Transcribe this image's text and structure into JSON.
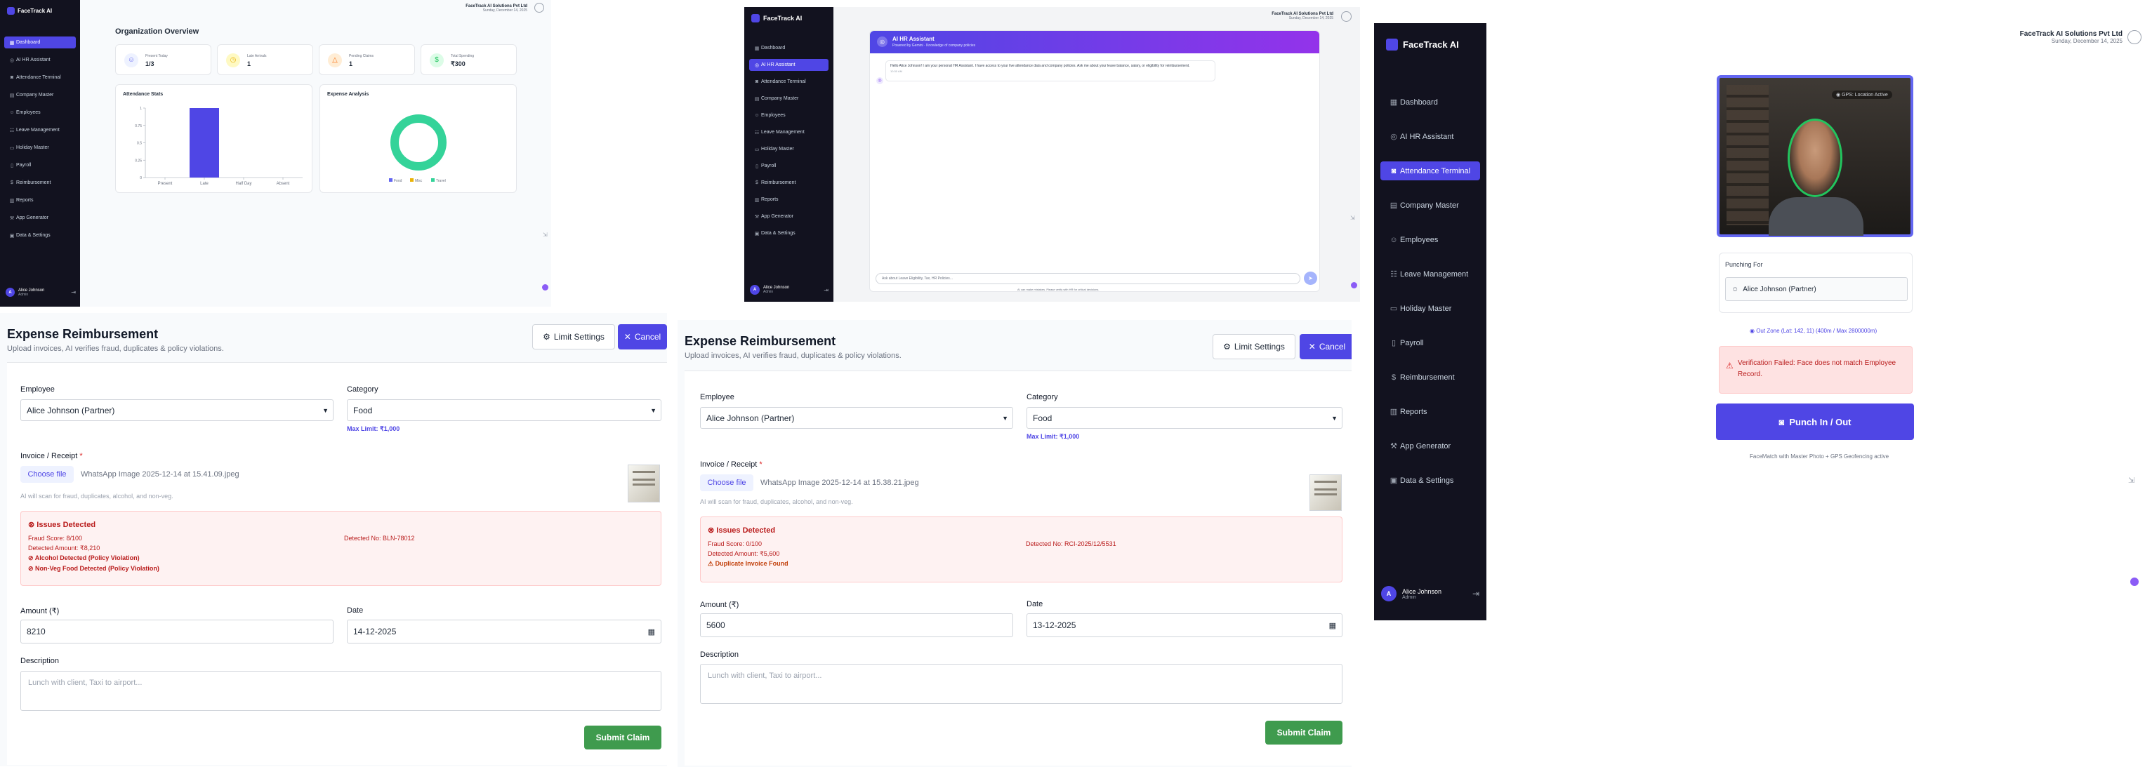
{
  "app": {
    "brand": "FaceTrack AI",
    "company": "FaceTrack AI Solutions Pvt Ltd",
    "date": "Sunday, December 14, 2025",
    "user_name": "Alice Johnson",
    "user_role": "Admin",
    "user_initial": "A"
  },
  "nav": {
    "dashboard": "Dashboard",
    "ai_hr": "AI HR Assistant",
    "attendance": "Attendance Terminal",
    "company": "Company Master",
    "employees": "Employees",
    "leave": "Leave Management",
    "holiday": "Holiday Master",
    "payroll": "Payroll",
    "reimbursement": "Reimbursement",
    "reports": "Reports",
    "app_gen": "App Generator",
    "data": "Data & Settings"
  },
  "dashboard": {
    "title": "Organization Overview",
    "stats": [
      {
        "label": "Present Today",
        "value": "1/3",
        "icon": "users-icon",
        "color": "#6366f1"
      },
      {
        "label": "Late Arrivals",
        "value": "1",
        "icon": "clock-icon",
        "color": "#eab308"
      },
      {
        "label": "Pending Claims",
        "value": "1",
        "icon": "alert-icon",
        "color": "#f97316"
      },
      {
        "label": "Total Spending",
        "value": "₹300",
        "icon": "dollar-icon",
        "color": "#22c55e"
      }
    ],
    "attendance_title": "Attendance Stats",
    "expense_title": "Expense Analysis"
  },
  "chart_data": [
    {
      "type": "bar",
      "title": "Attendance Stats",
      "categories": [
        "Present",
        "Late",
        "Half Day",
        "Absent"
      ],
      "values": [
        0,
        1,
        0,
        0
      ],
      "ylim": [
        0,
        1
      ],
      "yticks": [
        "0",
        "0.25",
        "0.5",
        "0.75",
        "1"
      ],
      "color": "#4f46e5"
    },
    {
      "type": "pie",
      "title": "Expense Analysis",
      "categories": [
        "Food",
        "Misc",
        "Travel"
      ],
      "values": [
        0,
        0,
        300
      ],
      "colors": [
        "#6366f1",
        "#eab308",
        "#34d399"
      ]
    }
  ],
  "assistant": {
    "title": "AI HR Assistant",
    "subtitle": "Powered by Gemini · Knowledge of company policies",
    "message": "Hello Alice Johnson! I am your personal HR Assistant. I have access to your live attendance data and company policies. Ask me about your leave balance, salary, or eligibility for reimbursement.",
    "time": "10:30 AM",
    "placeholder": "Ask about Leave Eligibility, Tax, HR Policies...",
    "footnote": "AI can make mistakes. Please verify with HR for critical decisions."
  },
  "expense": {
    "title": "Expense Reimbursement",
    "subtitle": "Upload invoices, AI verifies fraud, duplicates & policy violations.",
    "limit_btn": "Limit Settings",
    "cancel_btn": "Cancel",
    "employee_label": "Employee",
    "category_label": "Category",
    "invoice_label": "Invoice / Receipt",
    "choose_file": "Choose file",
    "ai_hint": "AI will scan for fraud, duplicates, alcohol, and non-veg.",
    "amount_label": "Amount (₹)",
    "date_label": "Date",
    "description_label": "Description",
    "desc_placeholder": "Lunch with client, Taxi to airport...",
    "submit": "Submit Claim",
    "issues_title": "Issues Detected",
    "left": {
      "employee": "Alice Johnson (Partner)",
      "category": "Food",
      "max_limit": "Max Limit: ₹1,000",
      "file_name": "WhatsApp Image 2025-12-14 at 15.41.09.jpeg",
      "fraud_score": "Fraud Score: 8/100",
      "detected_no": "Detected No: BLN-78012",
      "detected_amount": "Detected Amount: ₹8,210",
      "violation1": "Alcohol Detected (Policy Violation)",
      "violation2": "Non-Veg Food Detected (Policy Violation)",
      "amount": "8210",
      "date": "14-12-2025"
    },
    "right": {
      "employee": "Alice Johnson (Partner)",
      "category": "Food",
      "max_limit": "Max Limit: ₹1,000",
      "file_name": "WhatsApp Image 2025-12-14 at 15.38.21.jpeg",
      "fraud_score": "Fraud Score: 0/100",
      "detected_no": "Detected No: RCI-2025/12/5531",
      "detected_amount": "Detected Amount: ₹5,600",
      "violation1": "Duplicate Invoice Found",
      "amount": "5600",
      "date": "13-12-2025"
    }
  },
  "terminal": {
    "gps_badge": "GPS: Location Active",
    "punching_for_label": "Punching For",
    "punching_for": "Alice Johnson (Partner)",
    "location": "Out Zone (Lat: 142, 11) (400m / Max 2800000m)",
    "error": "Verification Failed: Face does not match Employee Record.",
    "punch_btn": "Punch In / Out",
    "footnote": "FaceMatch with Master Photo + GPS Geofencing active"
  }
}
